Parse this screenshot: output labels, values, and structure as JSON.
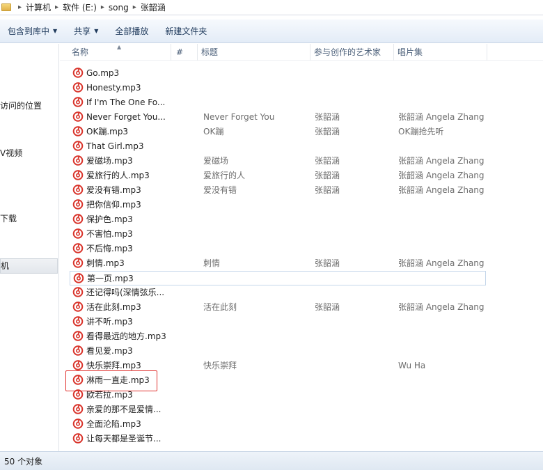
{
  "address": {
    "crumbs": [
      "计算机",
      "软件 (E:)",
      "song",
      "张韶涵"
    ]
  },
  "toolbar": {
    "include_library": "包含到库中",
    "share": "共享",
    "play_all": "全部播放",
    "new_folder": "新建文件夹"
  },
  "navpane": {
    "items": [
      "访问的位置",
      "V视频",
      "下载",
      "机"
    ],
    "fragments": [
      "",
      "",
      "",
      "",
      "",
      "",
      "",
      ""
    ]
  },
  "columns": {
    "name": "名称",
    "number": "#",
    "title": "标题",
    "artist": "参与创作的艺术家",
    "album": "唱片集"
  },
  "files": [
    {
      "name": "Go.mp3",
      "title": "",
      "artist": "",
      "album": ""
    },
    {
      "name": "Honesty.mp3",
      "title": "",
      "artist": "",
      "album": ""
    },
    {
      "name": "If I'm The One Fo...",
      "title": "",
      "artist": "",
      "album": ""
    },
    {
      "name": "Never Forget You...",
      "title": "Never Forget You",
      "artist": "张韶涵",
      "album": "张韶涵 Angela Zhang"
    },
    {
      "name": "OK蹦.mp3",
      "title": "OK蹦",
      "artist": "张韶涵",
      "album": "OK蹦抢先听"
    },
    {
      "name": "That Girl.mp3",
      "title": "",
      "artist": "",
      "album": ""
    },
    {
      "name": "爱磁场.mp3",
      "title": "爱磁场",
      "artist": "张韶涵",
      "album": "张韶涵 Angela Zhang"
    },
    {
      "name": "爱旅行的人.mp3",
      "title": "爱旅行的人",
      "artist": "张韶涵",
      "album": "张韶涵 Angela Zhang"
    },
    {
      "name": "爱没有错.mp3",
      "title": "爱没有错",
      "artist": "张韶涵",
      "album": "张韶涵 Angela Zhang"
    },
    {
      "name": "把你信仰.mp3",
      "title": "",
      "artist": "",
      "album": ""
    },
    {
      "name": "保护色.mp3",
      "title": "",
      "artist": "",
      "album": ""
    },
    {
      "name": "不害怕.mp3",
      "title": "",
      "artist": "",
      "album": ""
    },
    {
      "name": "不后悔.mp3",
      "title": "",
      "artist": "",
      "album": ""
    },
    {
      "name": "刺情.mp3",
      "title": "刺情",
      "artist": "张韶涵",
      "album": "张韶涵 Angela Zhang"
    },
    {
      "name": "第一页.mp3",
      "title": "",
      "artist": "",
      "album": ""
    },
    {
      "name": "还记得吗(深情弦乐...",
      "title": "",
      "artist": "",
      "album": ""
    },
    {
      "name": "活在此刻.mp3",
      "title": "活在此刻",
      "artist": "张韶涵",
      "album": "张韶涵 Angela Zhang"
    },
    {
      "name": "讲不听.mp3",
      "title": "",
      "artist": "",
      "album": ""
    },
    {
      "name": "看得最远的地方.mp3",
      "title": "",
      "artist": "",
      "album": ""
    },
    {
      "name": "看见爱.mp3",
      "title": "",
      "artist": "",
      "album": ""
    },
    {
      "name": "快乐崇拜.mp3",
      "title": "快乐崇拜",
      "artist": "",
      "album": "Wu Ha"
    },
    {
      "name": "淋雨一直走.mp3",
      "title": "",
      "artist": "",
      "album": ""
    },
    {
      "name": "欧若拉.mp3",
      "title": "",
      "artist": "",
      "album": ""
    },
    {
      "name": "亲爱的那不是爱情...",
      "title": "",
      "artist": "",
      "album": ""
    },
    {
      "name": "全面沦陷.mp3",
      "title": "",
      "artist": "",
      "album": ""
    },
    {
      "name": "让每天都是圣诞节...",
      "title": "",
      "artist": "",
      "album": ""
    }
  ],
  "focused_index": 14,
  "highlighted_index": 21,
  "status": {
    "count_text": "50 个对象"
  },
  "colors": {
    "icon_red": "#d9342b",
    "highlight_red": "#e0312e",
    "toolbar_text": "#1e395b",
    "header_text": "#4c607a"
  }
}
